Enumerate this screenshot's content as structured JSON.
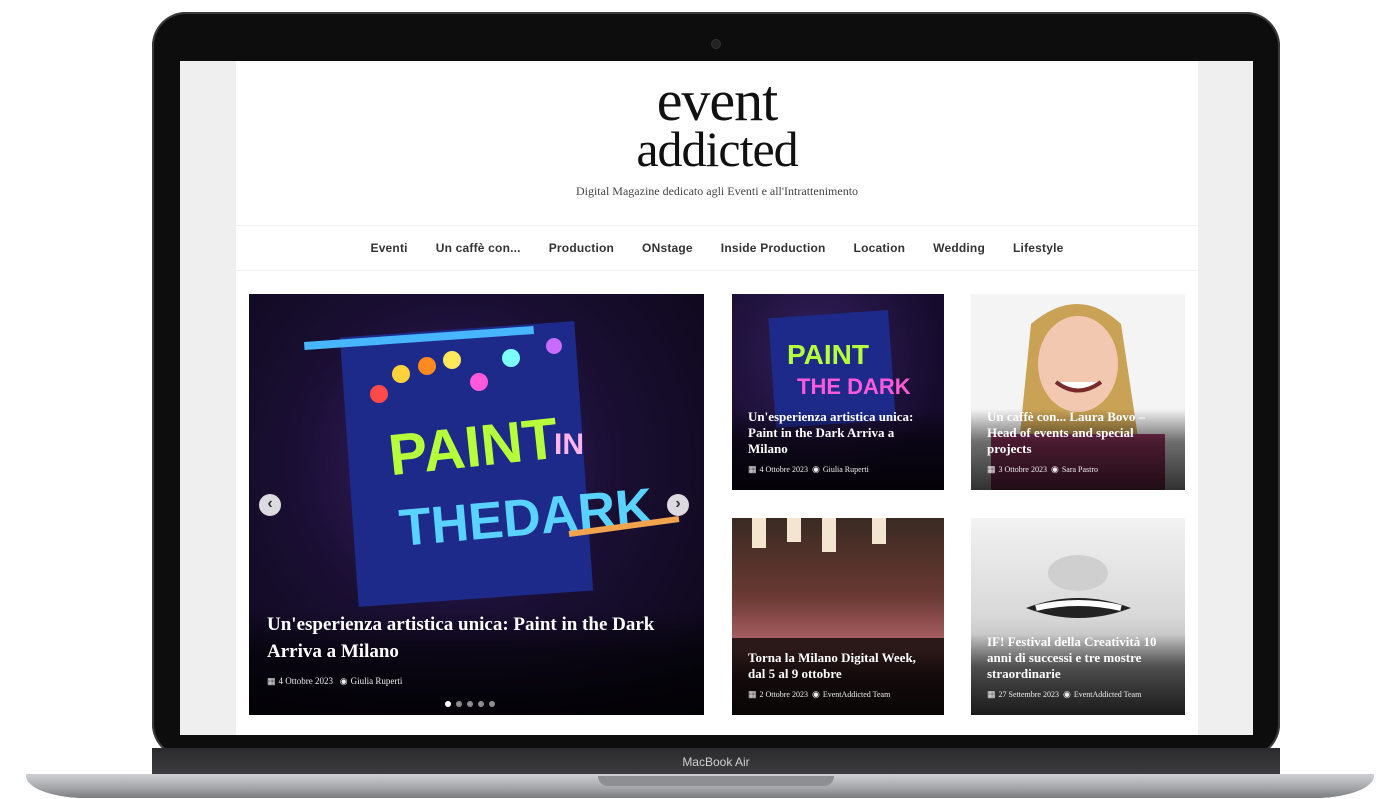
{
  "site": {
    "logo_line1": "event",
    "logo_line2": "addicted",
    "tagline": "Digital Magazine dedicato agli Eventi e all'Intrattenimento"
  },
  "nav": {
    "items": [
      "Eventi",
      "Un caffè con...",
      "Production",
      "ONstage",
      "Inside Production",
      "Location",
      "Wedding",
      "Lifestyle"
    ]
  },
  "slider": {
    "title": "Un'esperienza artistica unica: Paint in the Dark Arriva a Milano",
    "date": "4 Ottobre 2023",
    "author": "Giulia Ruperti",
    "prev_icon": "chevron-left-icon",
    "next_icon": "chevron-right-icon",
    "active_index": 0
  },
  "cards": [
    {
      "title": "Un'esperienza artistica unica: Paint in the Dark Arriva a Milano",
      "date": "4 Ottobre 2023",
      "author": "Giulia Ruperti"
    },
    {
      "title": "Un caffè con... Laura Bovo – Head of events and special projects",
      "date": "3 Ottobre 2023",
      "author": "Sara Pastro"
    },
    {
      "title": "Torna la Milano Digital Week, dal 5 al 9 ottobre",
      "date": "2 Ottobre 2023",
      "author": "EventAddicted Team"
    },
    {
      "title": "IF! Festival della Creatività 10 anni di successi e tre mostre straordinarie",
      "date": "27 Settembre 2023",
      "author": "EventAddicted Team"
    }
  ],
  "device": {
    "label": "MacBook Air"
  },
  "colors": {
    "bezel": "#0d0d0d",
    "overlay_text": "#ffffff"
  }
}
